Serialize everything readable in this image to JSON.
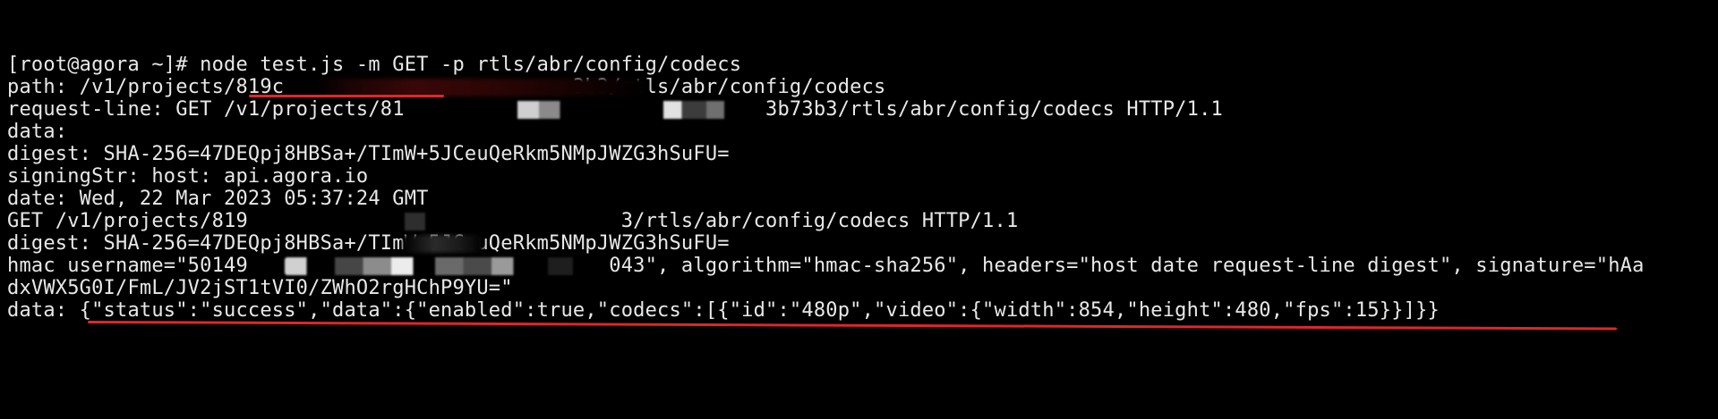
{
  "colors": {
    "background": "#000000",
    "text": "#e8e8e8",
    "annotation": "#e0262b"
  },
  "terminal": {
    "lines": [
      "[root@agora ~]# node test.js -m GET -p rtls/abr/config/codecs",
      "path: /v1/projects/819c                        3b3/rtls/abr/config/codecs",
      "request-line: GET /v1/projects/81                              3b73b3/rtls/abr/config/codecs HTTP/1.1",
      "data:",
      "digest: SHA-256=47DEQpj8HBSa+/TImW+5JCeuQeRkm5NMpJWZG3hSuFU=",
      "signingStr: host: api.agora.io",
      "date: Wed, 22 Mar 2023 05:37:24 GMT",
      "GET /v1/projects/819                               3/rtls/abr/config/codecs HTTP/1.1",
      "digest: SHA-256=47DEQpj8HBSa+/TImW+5JCeuQeRkm5NMpJWZG3hSuFU=",
      "hmac username=\"50149                              043\", algorithm=\"hmac-sha256\", headers=\"host date request-line digest\", signature=\"hAa",
      "dxVWX5G0I/FmL/JV2jST1tVI0/ZWhO2rgHChP9YU=\"",
      "data: {\"status\":\"success\",\"data\":{\"enabled\":true,\"codecs\":[{\"id\":\"480p\",\"video\":{\"width\":854,\"height\":480,\"fps\":15}}]}}"
    ]
  }
}
